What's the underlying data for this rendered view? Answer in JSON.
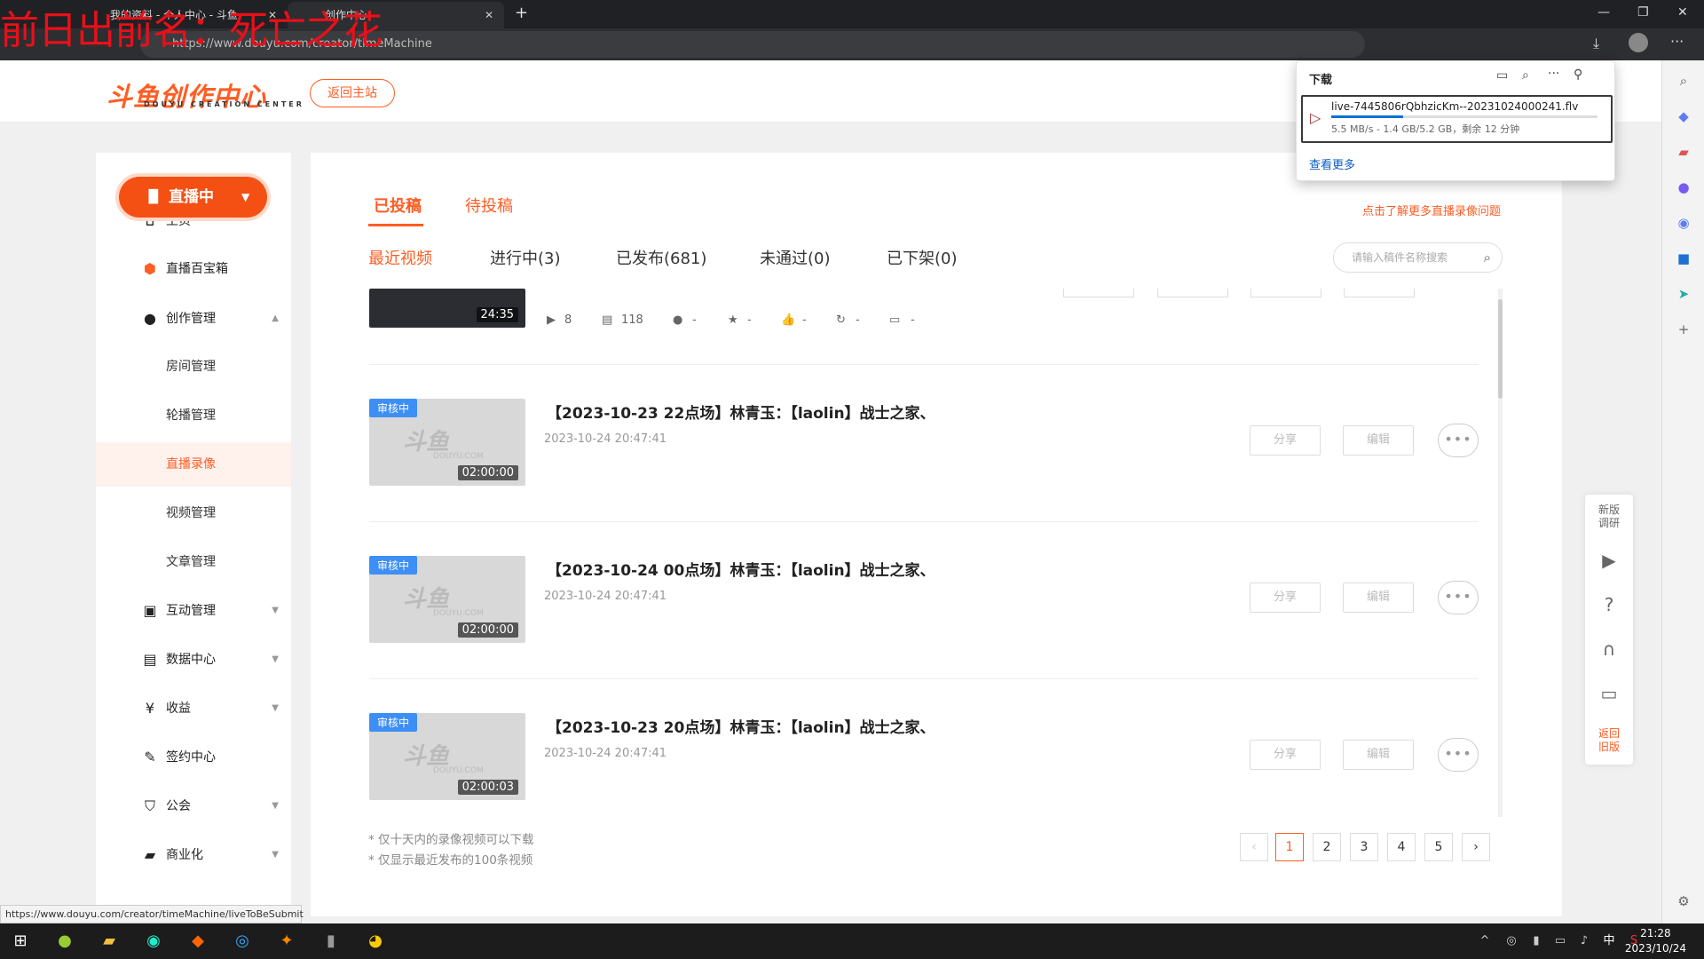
{
  "watermark": "前日出前名：死亡之花",
  "browser": {
    "tabs": [
      {
        "label": "我的资料 - 个人中心 - 斗鱼"
      },
      {
        "label": "创作中心"
      }
    ],
    "url": "https://www.douyu.com/creator/timeMachine"
  },
  "downloads": {
    "title": "下载",
    "file_name": "live-7445806rQbhzicKm--20231024000241.flv",
    "progress_text": "5.5 MB/s - 1.4 GB/5.2 GB，剩余 12 分钟",
    "progress": 0.27,
    "see_more": "查看更多"
  },
  "header": {
    "logo": "斗鱼创作中心",
    "logo_sub": "DOUYU CREATION CENTER",
    "back_button": "返回主站"
  },
  "sidebar": {
    "live_button": "直播中",
    "items": [
      {
        "label": "主页"
      },
      {
        "label": "直播百宝箱"
      },
      {
        "label": "创作管理"
      },
      {
        "label": "房间管理"
      },
      {
        "label": "轮播管理"
      },
      {
        "label": "直播录像"
      },
      {
        "label": "视频管理"
      },
      {
        "label": "文章管理"
      },
      {
        "label": "互动管理"
      },
      {
        "label": "数据中心"
      },
      {
        "label": "收益"
      },
      {
        "label": "签约中心"
      },
      {
        "label": "公会"
      },
      {
        "label": "商业化"
      }
    ]
  },
  "main": {
    "tabs": [
      {
        "label": "已投稿"
      },
      {
        "label": "待投稿"
      }
    ],
    "help_link": "点击了解更多直播录像问题",
    "subtabs": [
      {
        "label": "最近视频"
      },
      {
        "label": "进行中(3)"
      },
      {
        "label": "已发布(681)"
      },
      {
        "label": "未通过(0)"
      },
      {
        "label": "已下架(0)"
      }
    ],
    "search_placeholder": "请输入稿件名称搜索",
    "partial_row": {
      "duration": "24:35",
      "plays": "8",
      "comments": "118",
      "danmu": "-",
      "favorites": "-",
      "likes": "-",
      "shares": "-",
      "other": "-"
    },
    "rows": [
      {
        "badge": "审核中",
        "title": "【2023-10-23 22点场】林青玉：【laolin】战士之家、",
        "date": "2023-10-24 20:47:41",
        "duration": "02:00:00",
        "share": "分享",
        "edit": "编辑"
      },
      {
        "badge": "审核中",
        "title": "【2023-10-24 00点场】林青玉：【laolin】战士之家、",
        "date": "2023-10-24 20:47:41",
        "duration": "02:00:00",
        "share": "分享",
        "edit": "编辑"
      },
      {
        "badge": "审核中",
        "title": "【2023-10-23 20点场】林青玉：【laolin】战士之家、",
        "date": "2023-10-24 20:47:41",
        "duration": "02:00:03",
        "share": "分享",
        "edit": "编辑"
      }
    ],
    "thumb_watermark": "斗鱼",
    "thumb_watermark_sub": "DOUYU.COM",
    "notes": [
      "* 仅十天内的录像视频可以下载",
      "* 仅显示最近发布的100条视频"
    ],
    "pages": [
      "1",
      "2",
      "3",
      "4",
      "5"
    ],
    "prev": "‹",
    "next": "›"
  },
  "float_panel": {
    "survey": "新版\n调研",
    "old_version": "返回\n旧版"
  },
  "status_url": "https://www.douyu.com/creator/timeMachine/liveToBeSubmit",
  "clock": {
    "time": "21:28",
    "date": "2023/10/24"
  },
  "tray": {
    "ime": "中"
  }
}
